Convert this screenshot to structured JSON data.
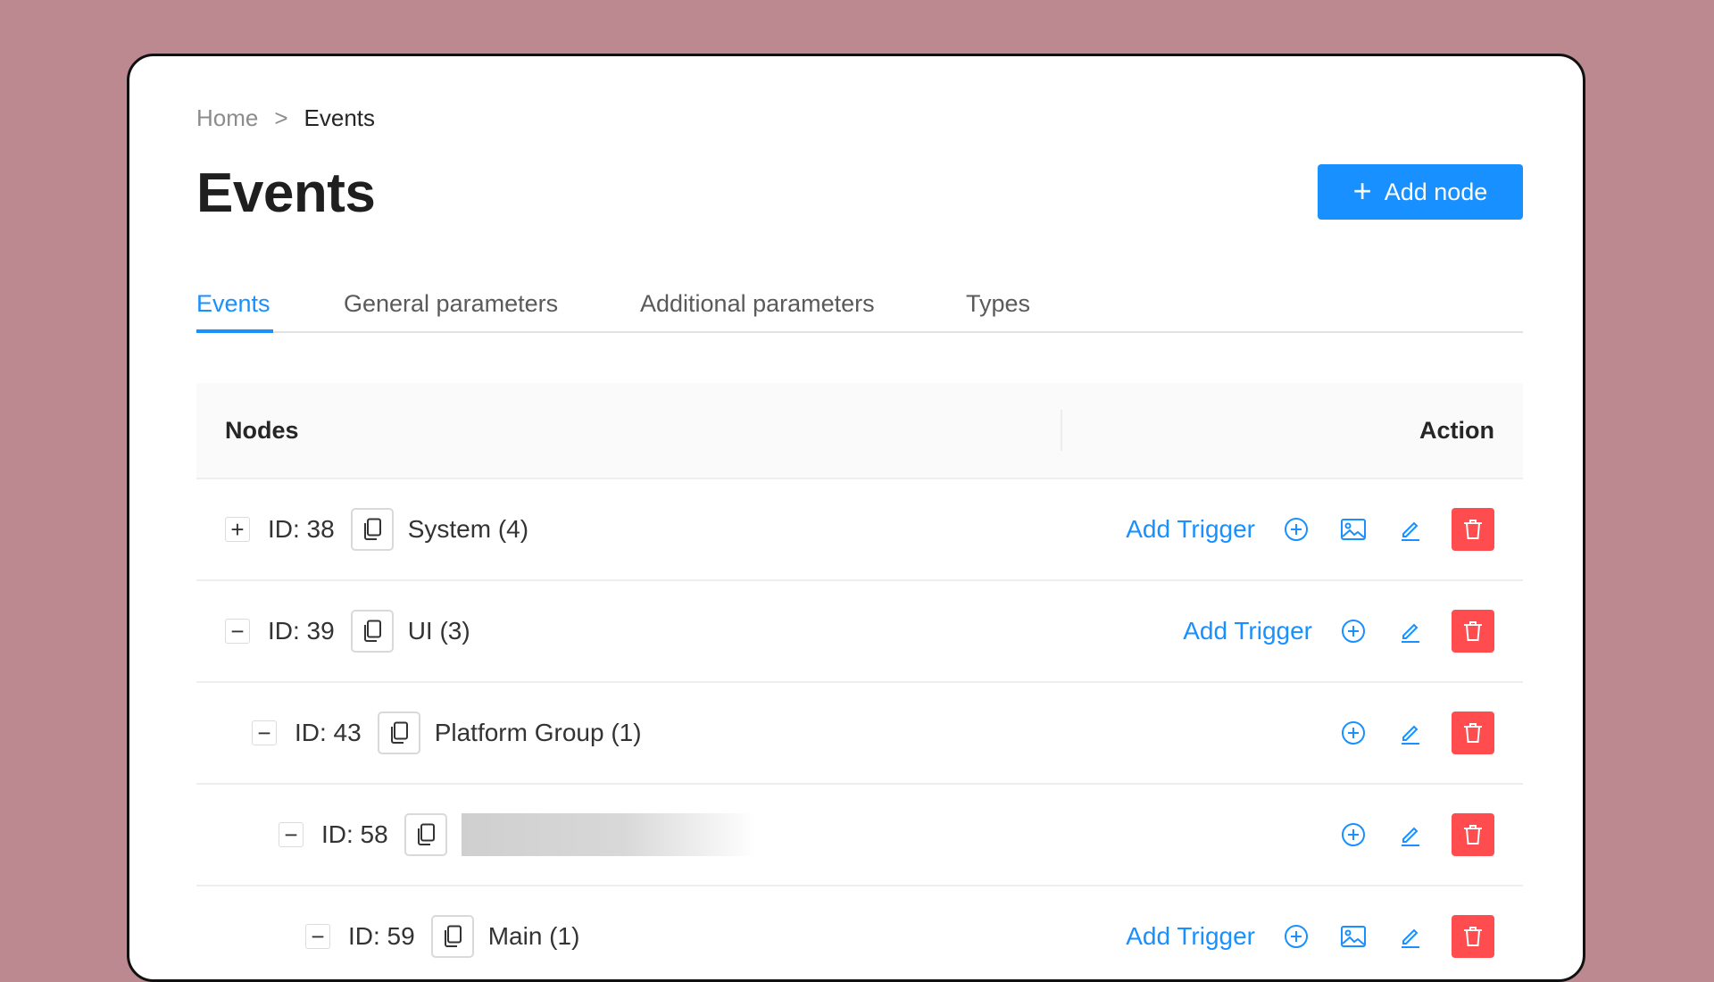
{
  "breadcrumb": {
    "home": "Home",
    "separator": ">",
    "current": "Events"
  },
  "header": {
    "title": "Events",
    "add_button_label": "Add node",
    "add_button_icon": "plus-icon"
  },
  "tabs": [
    {
      "label": "Events",
      "active": true
    },
    {
      "label": "General parameters",
      "active": false
    },
    {
      "label": "Additional parameters",
      "active": false
    },
    {
      "label": "Types",
      "active": false
    }
  ],
  "table": {
    "columns": {
      "nodes": "Nodes",
      "action": "Action"
    },
    "add_trigger_label": "Add Trigger",
    "rows": [
      {
        "expander": "+",
        "id": "ID: 38",
        "name": "System (4)",
        "depth": 0,
        "has_add_trigger": true,
        "has_image": true
      },
      {
        "expander": "−",
        "id": "ID: 39",
        "name": "UI (3)",
        "depth": 0,
        "has_add_trigger": true,
        "has_image": false
      },
      {
        "expander": "−",
        "id": "ID: 43",
        "name": "Platform Group (1)",
        "depth": 1,
        "has_add_trigger": false,
        "has_image": false
      },
      {
        "expander": "−",
        "id": "ID: 58",
        "name": "",
        "name_blurred": true,
        "depth": 2,
        "has_add_trigger": false,
        "has_image": false
      },
      {
        "expander": "−",
        "id": "ID: 59",
        "name": "Main (1)",
        "depth": 3,
        "has_add_trigger": true,
        "has_image": true
      }
    ]
  },
  "colors": {
    "primary": "#1890ff",
    "danger": "#ff4d4f",
    "background": "#bc8990"
  }
}
